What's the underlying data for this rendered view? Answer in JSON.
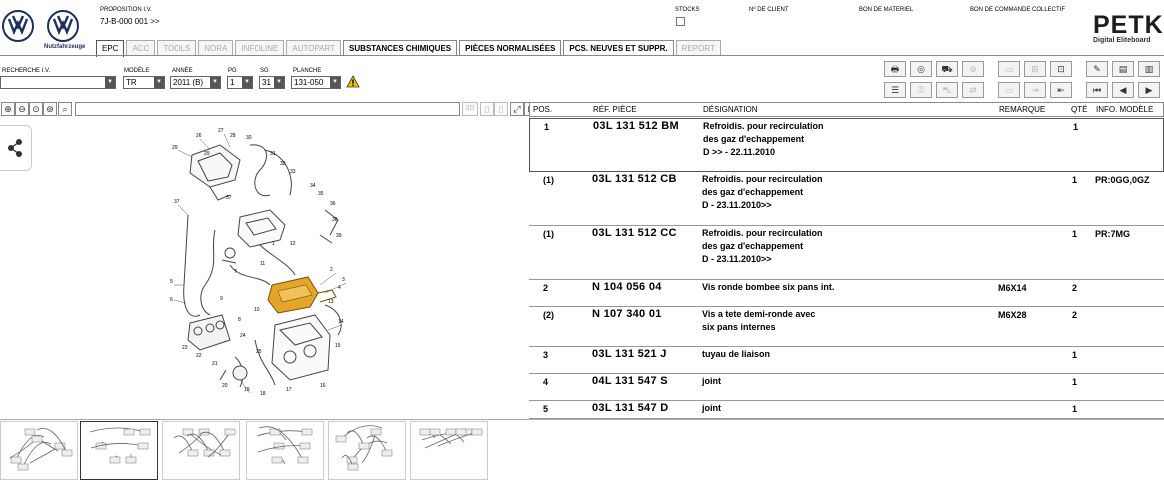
{
  "header": {
    "logo_subtitle": "Nutzfahrzeuge",
    "proposition_label": "PROPOSITION I.V.",
    "proposition_value": "7J-B-000 001 >>",
    "stocks_label": "STOCKS",
    "client_label": "Nº DE CLIENT",
    "bon_materiel_label": "BON DE MATERIEL",
    "bon_commande_label": "BON DE COMMANDE COLLECTIF",
    "brand": "PETKA",
    "brand_sub": "Digital Eliteboard"
  },
  "tabs": [
    {
      "label": "EPC",
      "state": "active"
    },
    {
      "label": "ACC",
      "state": "dim"
    },
    {
      "label": "TOOLS",
      "state": "dim"
    },
    {
      "label": "NORA",
      "state": "dim"
    },
    {
      "label": "INFOLINE",
      "state": "dim"
    },
    {
      "label": "AUTOPART",
      "state": "dim"
    },
    {
      "label": "SUBSTANCES CHIMIQUES",
      "state": "bold"
    },
    {
      "label": "PIÈCES NORMALISÉES",
      "state": "bold"
    },
    {
      "label": "PCS. NEUVES ET SUPPR.",
      "state": "bold"
    },
    {
      "label": "REPORT",
      "state": "dim"
    }
  ],
  "filters": {
    "recherche_label": "RECHERCHE I.V.",
    "recherche_value": "",
    "modele_label": "MODÈLE",
    "modele_value": "TR",
    "annee_label": "ANNÉE",
    "annee_value": "2011 (B)",
    "pg_label": "PG",
    "pg_value": "1",
    "sg_label": "SG",
    "sg_value": "31",
    "planche_label": "PLANCHE",
    "planche_value": "131-050"
  },
  "image_toolbar": {
    "view_3d": "3D"
  },
  "table": {
    "headers": {
      "pos": "POS.",
      "ref": "RÉF. PIÈCE",
      "des": "DÉSIGNATION",
      "rem": "REMARQUE",
      "qty": "QTÉ",
      "info": "INFO. MODÈLE"
    },
    "rows": [
      {
        "pos": "1",
        "ref": "03L 131 512 BM",
        "des1": "Refroidis. pour recirculation",
        "des2": "des gaz d'echappement",
        "des3": "D             >> - 22.11.2010",
        "rem": "",
        "qty": "1",
        "info": ""
      },
      {
        "pos": "(1)",
        "ref": "03L 131 512 CB",
        "des1": "Refroidis. pour recirculation",
        "des2": "des gaz d'echappement",
        "des3": "D - 23.11.2010>>",
        "rem": "",
        "qty": "1",
        "info": "PR:0GG,0GZ"
      },
      {
        "pos": "(1)",
        "ref": "03L 131 512 CC",
        "des1": "Refroidis. pour recirculation",
        "des2": "des gaz d'echappement",
        "des3": "D - 23.11.2010>>",
        "rem": "",
        "qty": "1",
        "info": "PR:7MG"
      },
      {
        "pos": "2",
        "ref": "N   104 056 04",
        "des1": "Vis ronde bombee six pans int.",
        "des2": "",
        "des3": "",
        "rem": "M6X14",
        "qty": "2",
        "info": ""
      },
      {
        "pos": "(2)",
        "ref": "N   107 340 01",
        "des1": "Vis a tete demi-ronde avec",
        "des2": "six pans internes",
        "des3": "",
        "rem": "M6X28",
        "qty": "2",
        "info": ""
      },
      {
        "pos": "3",
        "ref": "03L 131 521 J",
        "des1": "tuyau de liaison",
        "des2": "",
        "des3": "",
        "rem": "",
        "qty": "1",
        "info": ""
      },
      {
        "pos": "4",
        "ref": "04L 131 547 S",
        "des1": "joint",
        "des2": "",
        "des3": "",
        "rem": "",
        "qty": "1",
        "info": ""
      },
      {
        "pos": "5",
        "ref": "03L 131 547 D",
        "des1": "joint",
        "des2": "",
        "des3": "",
        "rem": "",
        "qty": "1",
        "info": ""
      }
    ]
  },
  "diagram_callouts": [
    "26",
    "27",
    "28",
    "29",
    "29",
    "30",
    "31",
    "32",
    "33",
    "34",
    "35",
    "36",
    "37",
    "37",
    "38",
    "39",
    "1",
    "2",
    "3",
    "4",
    "5",
    "6",
    "7",
    "8",
    "9",
    "10",
    "11",
    "12",
    "13",
    "14",
    "15",
    "16",
    "17",
    "18",
    "19",
    "20",
    "21",
    "22",
    "23",
    "24",
    "25"
  ],
  "colors": {
    "vw_blue": "#1b2f5c",
    "highlight_part": "#e3a62b",
    "warning": "#f2c200"
  }
}
